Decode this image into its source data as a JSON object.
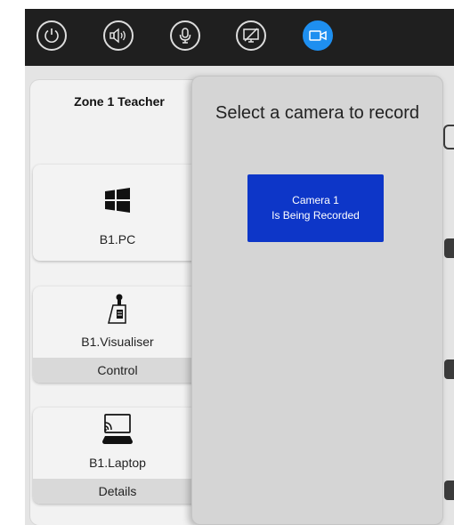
{
  "topbar": {
    "buttons": [
      {
        "icon": "power-icon"
      },
      {
        "icon": "speaker-icon"
      },
      {
        "icon": "microphone-icon"
      },
      {
        "icon": "screen-off-icon"
      },
      {
        "icon": "video-camera-icon",
        "active": true
      }
    ],
    "active_color": "#1e8ff0"
  },
  "zone": {
    "title": "Zone 1 Teacher"
  },
  "sources": [
    {
      "icon": "windows-icon",
      "label": "B1.PC",
      "action": ""
    },
    {
      "icon": "visualiser-icon",
      "label": "B1.Visualiser",
      "action": "Control"
    },
    {
      "icon": "cast-laptop-icon",
      "label": "B1.Laptop",
      "action": "Details"
    }
  ],
  "popup": {
    "title": "Select a camera to record",
    "camera_button": {
      "line1": "Camera 1",
      "line2": "Is Being Recorded",
      "color": "#0d36c8"
    }
  }
}
